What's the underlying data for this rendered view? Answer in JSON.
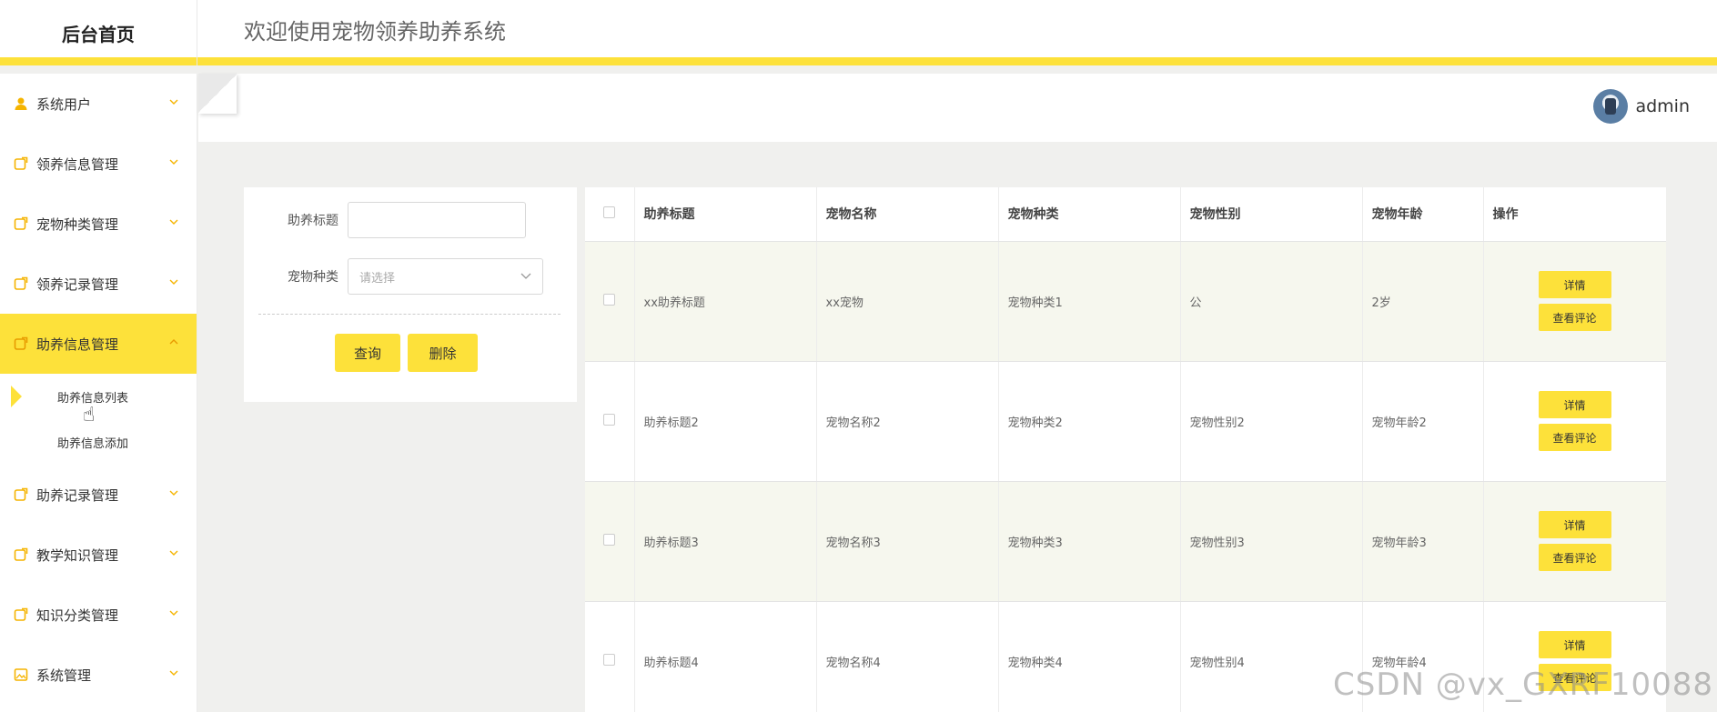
{
  "header": {
    "logo": "后台首页",
    "title": "欢迎使用宠物领养助养系统"
  },
  "user": {
    "name": "admin"
  },
  "sidebar": {
    "items": [
      {
        "label": "系统用户",
        "icon": "user-icon"
      },
      {
        "label": "领养信息管理",
        "icon": "edit-icon"
      },
      {
        "label": "宠物种类管理",
        "icon": "edit-icon"
      },
      {
        "label": "领养记录管理",
        "icon": "edit-icon"
      },
      {
        "label": "助养信息管理",
        "icon": "edit-icon",
        "active": true
      },
      {
        "label": "助养记录管理",
        "icon": "edit-icon"
      },
      {
        "label": "教学知识管理",
        "icon": "edit-icon"
      },
      {
        "label": "知识分类管理",
        "icon": "edit-icon"
      },
      {
        "label": "系统管理",
        "icon": "image-icon"
      }
    ],
    "sub_items": [
      {
        "label": "助养信息列表",
        "active": true
      },
      {
        "label": "助养信息添加"
      }
    ]
  },
  "search": {
    "title_label": "助养标题",
    "title_value": "",
    "type_label": "宠物种类",
    "type_placeholder": "请选择",
    "query_button": "查询",
    "delete_button": "删除"
  },
  "table": {
    "headers": [
      "助养标题",
      "宠物名称",
      "宠物种类",
      "宠物性别",
      "宠物年龄",
      "操作"
    ],
    "rows": [
      [
        "xx助养标题",
        "xx宠物",
        "宠物种类1",
        "公",
        "2岁"
      ],
      [
        "助养标题2",
        "宠物名称2",
        "宠物种类2",
        "宠物性别2",
        "宠物年龄2"
      ],
      [
        "助养标题3",
        "宠物名称3",
        "宠物种类3",
        "宠物性别3",
        "宠物年龄3"
      ],
      [
        "助养标题4",
        "宠物名称4",
        "宠物种类4",
        "宠物性别4",
        "宠物年龄4"
      ]
    ],
    "detail_button": "详情",
    "comment_button": "查看评论"
  },
  "watermark": "CSDN @vx_GXRF10088",
  "colors": {
    "accent": "#fde13a",
    "icon": "#f5b400",
    "row_alt": "#f6f7ee"
  }
}
